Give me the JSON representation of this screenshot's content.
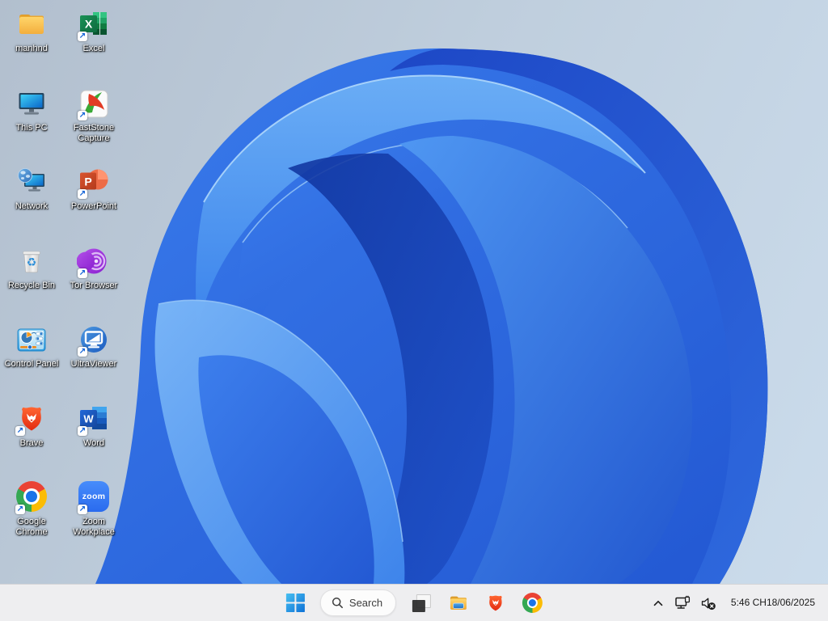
{
  "desktop": {
    "icons": [
      {
        "label": "manhnd",
        "type": "folder",
        "shortcut": false
      },
      {
        "label": "Excel",
        "type": "excel",
        "shortcut": true,
        "logo_letter": "X"
      },
      {
        "label": "This PC",
        "type": "this-pc",
        "shortcut": false
      },
      {
        "label": "FastStone Capture",
        "type": "faststone",
        "shortcut": true
      },
      {
        "label": "Network",
        "type": "network",
        "shortcut": false
      },
      {
        "label": "PowerPoint",
        "type": "powerpoint",
        "shortcut": true,
        "logo_letter": "P"
      },
      {
        "label": "Recycle Bin",
        "type": "recycle-bin",
        "shortcut": false
      },
      {
        "label": "Tor Browser",
        "type": "tor",
        "shortcut": true
      },
      {
        "label": "Control Panel",
        "type": "control-panel",
        "shortcut": false
      },
      {
        "label": "UltraViewer",
        "type": "ultraviewer",
        "shortcut": true
      },
      {
        "label": "Brave",
        "type": "brave",
        "shortcut": true
      },
      {
        "label": "Word",
        "type": "word",
        "shortcut": true,
        "logo_letter": "W"
      },
      {
        "label": "Google Chrome",
        "type": "chrome",
        "shortcut": true
      },
      {
        "label": "Zoom Workplace",
        "type": "zoom",
        "shortcut": true,
        "logo_text": "zoom"
      }
    ]
  },
  "taskbar": {
    "start": {
      "name": "start-button"
    },
    "search": {
      "label": "Search"
    },
    "pinned": [
      {
        "name": "stacked-windows"
      },
      {
        "name": "file-explorer"
      },
      {
        "name": "brave"
      },
      {
        "name": "chrome"
      }
    ],
    "tray": {
      "icons": [
        "chevron-up",
        "ethernet-network",
        "volume-muted"
      ],
      "time": "5:46 CH",
      "date": "18/06/2025"
    }
  },
  "theme": {
    "taskbar_bg": "#eeeef0",
    "accent_blue": "#0b6fd0",
    "bloom_blue_bright": "#4f97f2",
    "bloom_blue_deep": "#10349e",
    "desktop_bg_top": "#b2bfce",
    "desktop_bg_bottom": "#cbdcec"
  }
}
